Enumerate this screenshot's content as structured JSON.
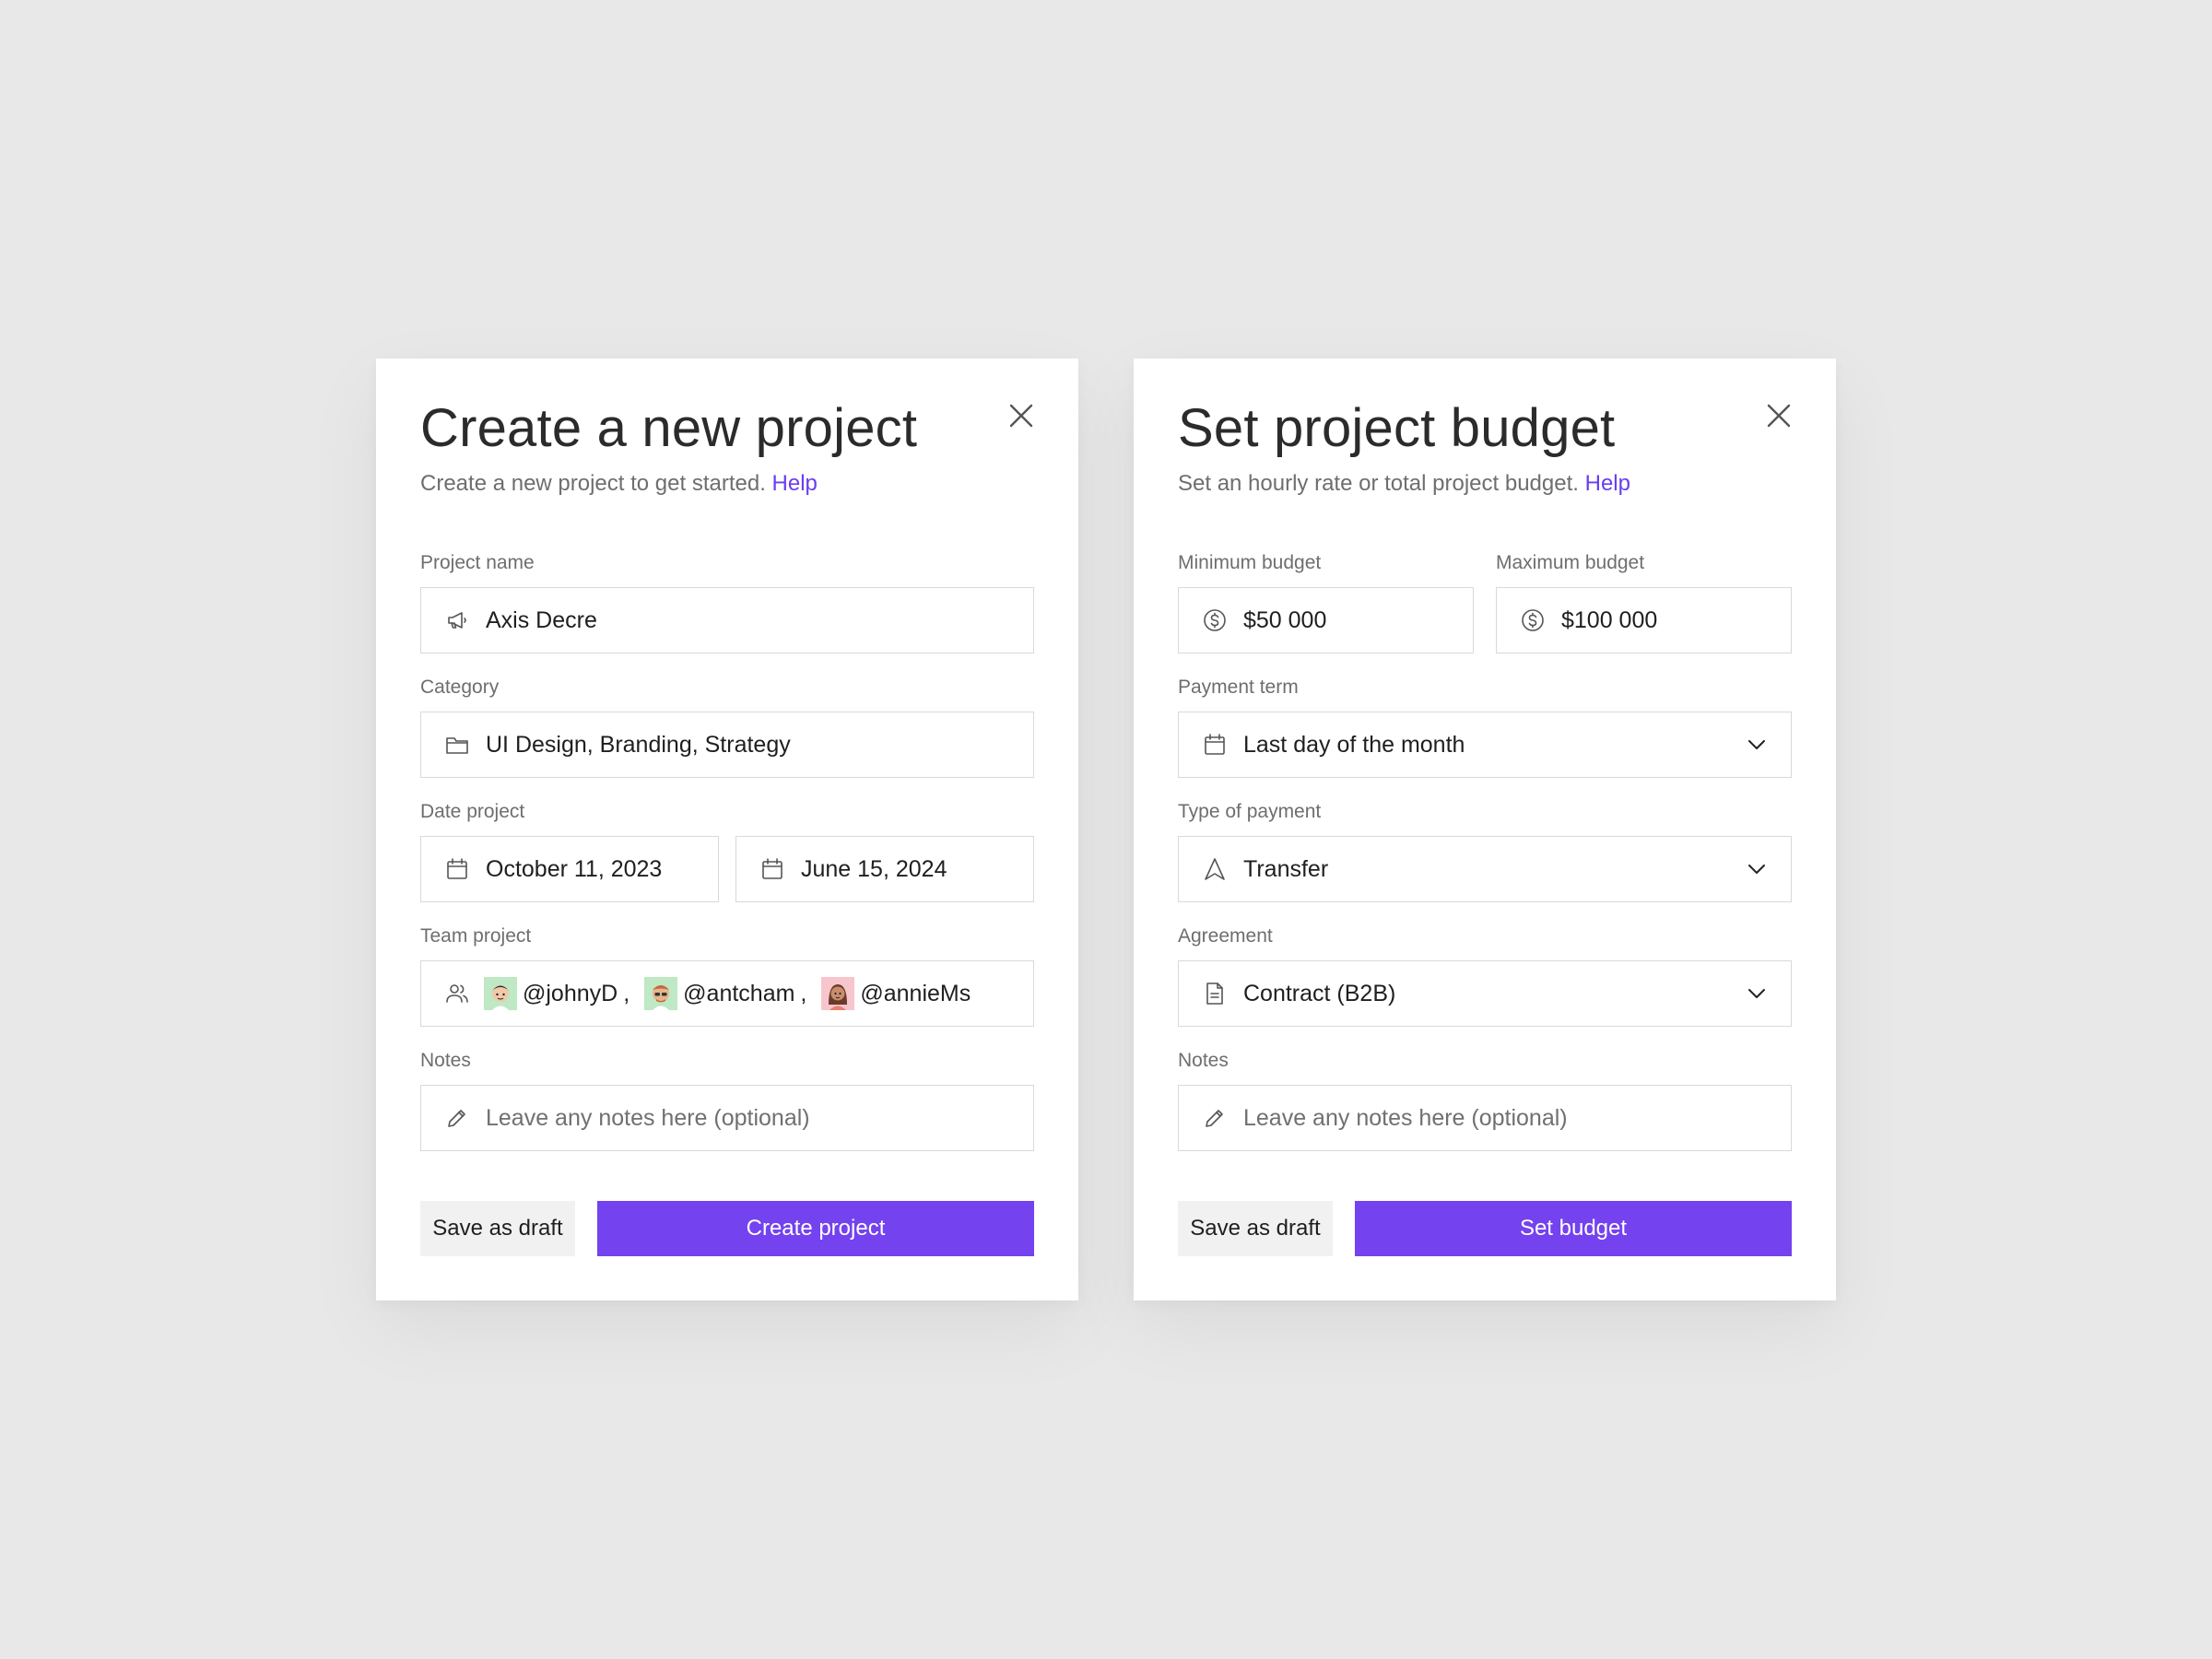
{
  "colors": {
    "background": "#e8e8e8",
    "card": "#ffffff",
    "accent": "#7442ee",
    "link": "#6a3df0",
    "border": "#d9d9d9",
    "muted_text": "#6e6e6e",
    "draft_button": "#f1f1f1"
  },
  "project_modal": {
    "title": "Create a new project",
    "subtitle": "Create a new project to get started.",
    "help_link": "Help",
    "close_icon": "close-icon",
    "project_name": {
      "label": "Project name",
      "value": "Axis Decre",
      "icon": "megaphone-icon"
    },
    "category": {
      "label": "Category",
      "value": "UI Design, Branding, Strategy",
      "icon": "folder-icon"
    },
    "date": {
      "label": "Date project",
      "start": "October 11, 2023",
      "end": "June 15, 2024",
      "icon": "calendar-icon"
    },
    "team": {
      "label": "Team project",
      "icon": "users-icon",
      "separator": ",",
      "members": [
        {
          "handle": "@johnyD",
          "avatar_bg": "#bfe8c4"
        },
        {
          "handle": "@antcham",
          "avatar_bg": "#bfe8c4"
        },
        {
          "handle": "@annieMs",
          "avatar_bg": "#f6c6cc"
        }
      ]
    },
    "notes": {
      "label": "Notes",
      "placeholder": "Leave any notes here (optional)",
      "icon": "pencil-icon"
    },
    "save_draft_label": "Save as draft",
    "primary_label": "Create project"
  },
  "budget_modal": {
    "title": "Set project budget",
    "subtitle": "Set an hourly rate or total project budget.",
    "help_link": "Help",
    "close_icon": "close-icon",
    "min_budget": {
      "label": "Minimum budget",
      "value": "$50 000",
      "icon": "dollar-circle-icon"
    },
    "max_budget": {
      "label": "Maximum budget",
      "value": "$100 000",
      "icon": "dollar-circle-icon"
    },
    "payment_term": {
      "label": "Payment term",
      "value": "Last day of the month",
      "icon": "calendar-icon"
    },
    "payment_type": {
      "label": "Type of payment",
      "value": "Transfer",
      "icon": "navigation-arrow-icon"
    },
    "agreement": {
      "label": "Agreement",
      "value": "Contract (B2B)",
      "icon": "document-icon"
    },
    "notes": {
      "label": "Notes",
      "placeholder": "Leave any notes here (optional)",
      "icon": "pencil-icon"
    },
    "save_draft_label": "Save as draft",
    "primary_label": "Set budget"
  }
}
